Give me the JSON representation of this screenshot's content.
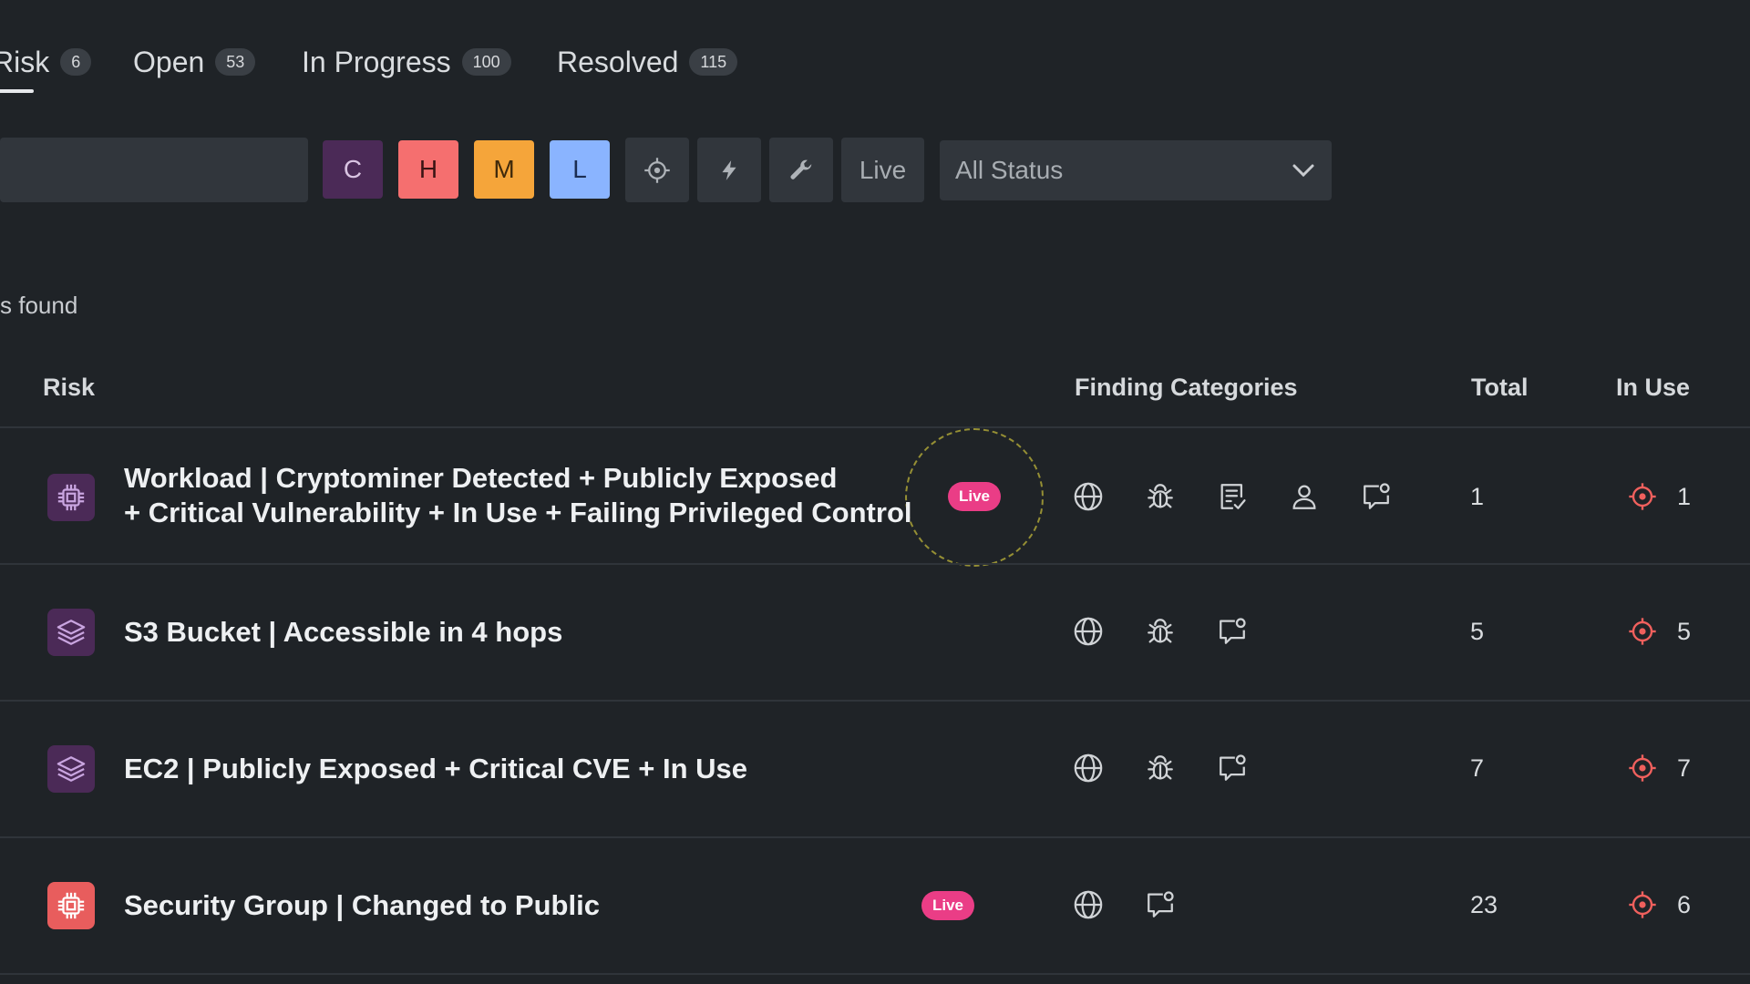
{
  "tabs": [
    {
      "label": "Risk",
      "count": "6",
      "active": true
    },
    {
      "label": "Open",
      "count": "53"
    },
    {
      "label": "In Progress",
      "count": "100"
    },
    {
      "label": "Resolved",
      "count": "115"
    }
  ],
  "filters": {
    "severity": [
      {
        "label": "C",
        "color": "#4b2a57",
        "text_color": "#d9c4e2"
      },
      {
        "label": "H",
        "color": "#f56f6f",
        "text_color": "#3b1414"
      },
      {
        "label": "M",
        "color": "#f5a53a",
        "text_color": "#402a0b"
      },
      {
        "label": "L",
        "color": "#8ab4ff",
        "text_color": "#1b2d52"
      }
    ],
    "tools": [
      "crosshair-icon",
      "bolt-icon",
      "wrench-icon"
    ],
    "live_label": "Live",
    "status_select": "All Status"
  },
  "found_text": "s found",
  "table": {
    "headers": {
      "risk": "Risk",
      "categories": "Finding Categories",
      "total": "Total",
      "in_use": "In Use"
    },
    "rows": [
      {
        "title_line1": "Workload | Cryptominer Detected + Publicly Exposed",
        "title_line2": "+ Critical Vulnerability + In Use + Failing Privileged Control",
        "icon": "chip-icon",
        "icon_bg": "#4b2a57",
        "icon_color": "#c9a5e0",
        "live": "Live",
        "categories": [
          "globe-icon",
          "bug-icon",
          "checklist-icon",
          "user-icon",
          "comment-icon"
        ],
        "total": "1",
        "in_use": "1"
      },
      {
        "title_line1": "S3 Bucket | Accessible in 4 hops",
        "icon": "layers-icon",
        "icon_bg": "#4b2a57",
        "icon_color": "#c9a5e0",
        "categories": [
          "globe-icon",
          "bug-icon",
          "comment-icon"
        ],
        "total": "5",
        "in_use": "5"
      },
      {
        "title_line1": "EC2 | Publicly Exposed + Critical CVE + In Use",
        "icon": "layers-icon",
        "icon_bg": "#4b2a57",
        "icon_color": "#c9a5e0",
        "categories": [
          "globe-icon",
          "bug-icon",
          "comment-icon"
        ],
        "total": "7",
        "in_use": "7"
      },
      {
        "title_line1": "Security Group | Changed to Public",
        "icon": "chip-icon",
        "icon_bg": "#e85d5d",
        "icon_color": "#ffffff",
        "live": "Live",
        "categories": [
          "globe-icon",
          "comment-icon"
        ],
        "total": "23",
        "in_use": "6"
      }
    ]
  },
  "colors": {
    "accent_red": "#f0605d",
    "live_pink": "#ea3d86"
  }
}
